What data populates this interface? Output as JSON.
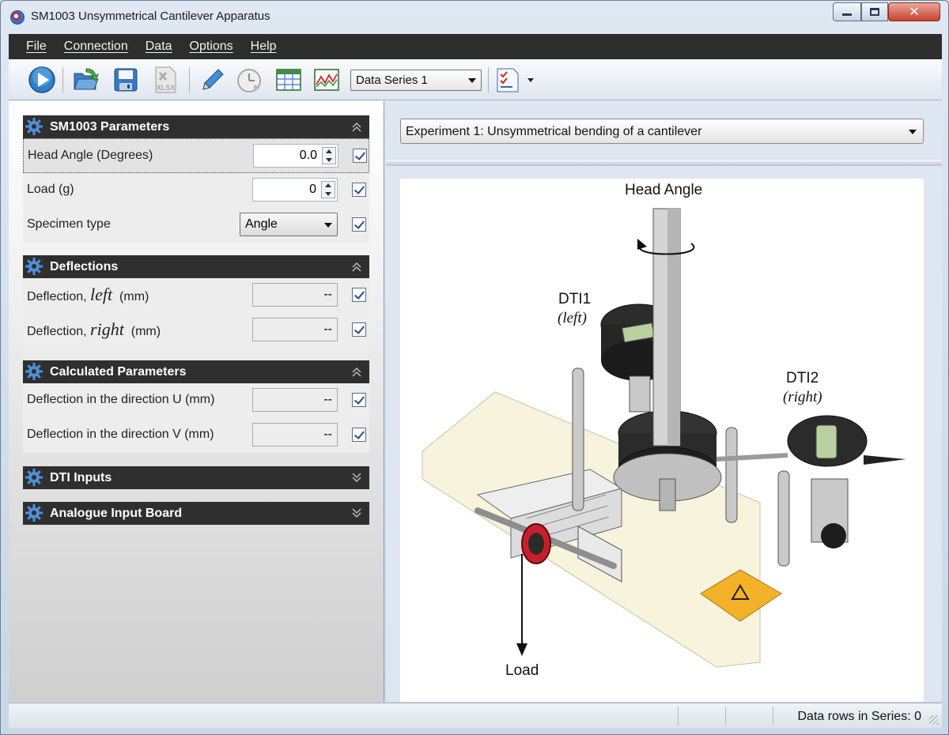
{
  "window": {
    "title": "SM1003 Unsymmetrical Cantilever Apparatus"
  },
  "menu": [
    "File",
    "Connection",
    "Data",
    "Options",
    "Help"
  ],
  "toolbar": {
    "icons": [
      "play-icon",
      "open-folder-icon",
      "save-icon",
      "export-xlsx-icon",
      "pencil-icon",
      "clock-icon",
      "table-icon",
      "chart-icon",
      "checklist-icon"
    ],
    "xlsx_label": "XLSX",
    "data_series": "Data Series 1"
  },
  "sections": {
    "parameters": {
      "title": "SM1003 Parameters",
      "head_angle_label": "Head Angle  (Degrees)",
      "head_angle_value": "0.0",
      "load_label": "Load  (g)",
      "load_value": "0",
      "specimen_label": "Specimen type",
      "specimen_value": "Angle"
    },
    "deflections": {
      "title": "Deflections",
      "left_prefix": "Deflection, ",
      "left_italic": "left",
      "left_unit": "  (mm)",
      "left_value": "--",
      "right_prefix": "Deflection, ",
      "right_italic": "right",
      "right_unit": "  (mm)",
      "right_value": "--"
    },
    "calculated": {
      "title": "Calculated Parameters",
      "u_label": "Deflection in the direction U  (mm)",
      "u_value": "--",
      "v_label": "Deflection in the direction V  (mm)",
      "v_value": "--"
    },
    "dti": {
      "title": "DTI Inputs"
    },
    "analogue": {
      "title": "Analogue Input Board"
    }
  },
  "experiment": {
    "selected": "Experiment 1: Unsymmetrical bending of a cantilever"
  },
  "diagram": {
    "head_angle": "Head Angle",
    "dti1": "DTI1",
    "dti1_sub": "(left)",
    "dti2": "DTI2",
    "dti2_sub": "(right)",
    "load": "Load"
  },
  "status": {
    "rows": "Data rows in Series: 0"
  }
}
